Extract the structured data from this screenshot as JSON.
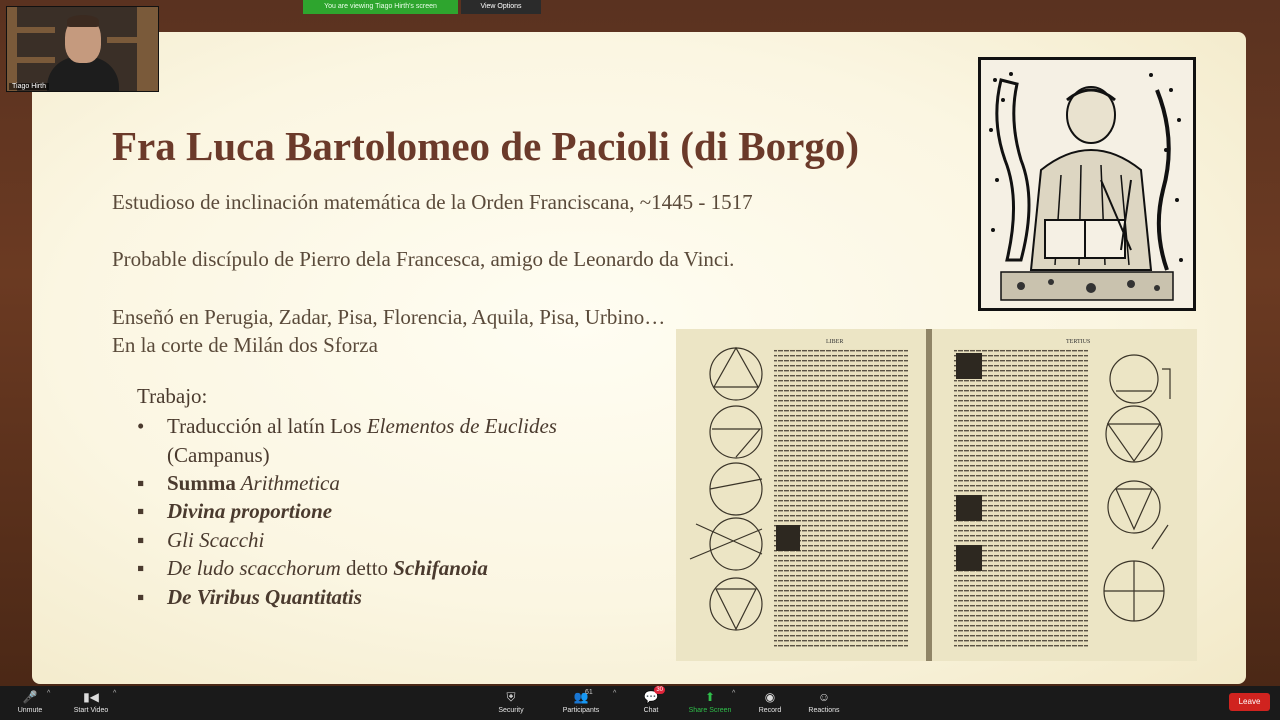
{
  "zoom": {
    "banner": "You are viewing Tiago Hirth's screen",
    "view_options": "View Options",
    "participant_name": "Tiago Hirth"
  },
  "slide": {
    "title": "Fra Luca Bartolomeo de Pacioli (di Borgo)",
    "line1": "Estudioso de inclinación matemática de la Orden Franciscana, ~1445 - 1517",
    "line2": "Probable discípulo de Pierro dela Francesca, amigo de Leonardo da Vinci.",
    "line3": "Enseñó en Perugia, Zadar, Pisa, Florencia, Aquila, Pisa, Urbino…",
    "line4": "En la corte de Milán dos Sforza",
    "work_label": "Trabajo:",
    "works": {
      "w1_plain": "Traducción al latín Los ",
      "w1_italic": "Elementos  de Euclides",
      "w1_cont": "(Campanus)",
      "w2_bold": "Summa",
      "w2_italic": " Arithmetica",
      "w3": "Divina proportione",
      "w4": "Gli Scacchi",
      "w5_italic": "De ludo scacchorum",
      "w5_plain": " detto ",
      "w5_bold": "Schifanoia",
      "w6": "De Viribus Quantitatis"
    },
    "bullets": {
      "round": "•",
      "square": "▪"
    },
    "book": {
      "left_header": "LIBER",
      "right_header": "TERTIUS"
    }
  },
  "toolbar": {
    "unmute": "Unmute",
    "start_video": "Start Video",
    "security": "Security",
    "participants": "Participants",
    "participants_count": "61",
    "chat": "Chat",
    "chat_badge": "30",
    "share_screen": "Share Screen",
    "record": "Record",
    "reactions": "Reactions",
    "leave": "Leave",
    "caret": "^"
  },
  "icons": {
    "mic": "🎤",
    "video": "▮◀",
    "shield": "⛨",
    "people": "👥",
    "chat": "💬",
    "share": "⬆",
    "record": "◉",
    "smile": "☺"
  }
}
